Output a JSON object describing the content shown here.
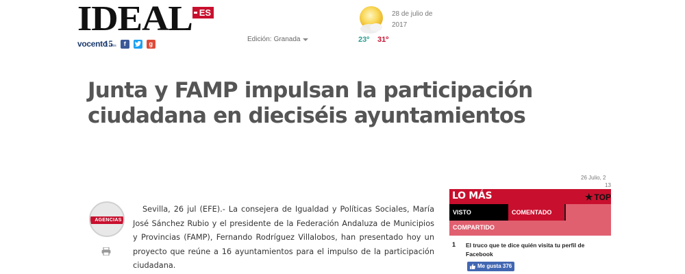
{
  "header": {
    "logo_text": "IDEAL",
    "logo_suffix": "ES",
    "vocento_text": "vocento",
    "vocento_15": "15",
    "vocento_anos": "años",
    "social_icons": [
      "facebook-icon",
      "twitter-icon",
      "google-plus-icon"
    ],
    "edition_label": "Edición:",
    "edition_value": "Granada",
    "weather": {
      "icon": "sun-cloud-icon",
      "temp_min": "23º",
      "temp_max": "31º"
    },
    "date": "28 de julio de 2017"
  },
  "article": {
    "headline": "Junta y FAMP impulsan la participación ciudadana en dieciséis ayuntamientos",
    "pub_date": "26 Julio, 2",
    "pub_time": "13",
    "agency_label": "AGENCIAS",
    "body": "Sevilla, 26 jul (EFE).- La consejera de Igualdad y Políticas Sociales, María José Sánchez Rubio y el presidente de la Federación Andaluza de Municipios y Provincias (FAMP), Fernando Rodríguez Villalobos, han presentado hoy un proyecto que reúne a 16 ayuntamientos para el impulso de la participación ciudadana."
  },
  "widget": {
    "title": "LO MÁS",
    "top_label": "TOP",
    "tabs": [
      "VISTO",
      "COMENTADO",
      "COMPARTIDO"
    ],
    "items": [
      {
        "rank": "1",
        "text": "El truco que te dice quién visita tu perfil de Facebook",
        "like_label": "Me gusta 376"
      }
    ]
  },
  "colors": {
    "brand_red": "#c8102e",
    "tab_pink": "#e06070",
    "facebook_blue": "#4267b2"
  }
}
